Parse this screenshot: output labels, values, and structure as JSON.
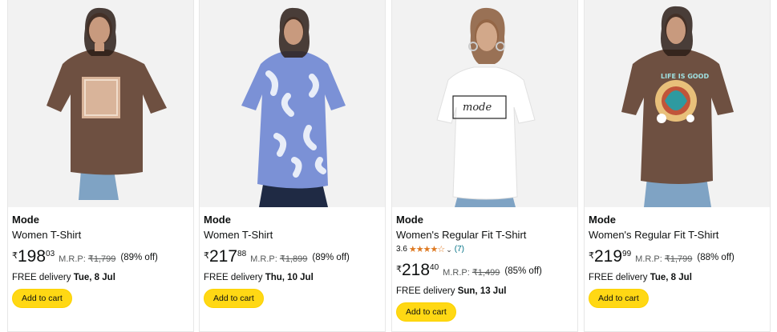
{
  "products": [
    {
      "brand": "Mode",
      "title": "Women T-Shirt",
      "currency": "₹",
      "price_whole": "198",
      "price_fraction": "03",
      "mrp_label": "M.R.P:",
      "mrp_value": "₹1,799",
      "discount": "(89% off)",
      "delivery_prefix": "FREE delivery",
      "delivery_date": "Tue, 8 Jul",
      "button_label": "Add to cart",
      "shirt_color": "#6e5041",
      "image_icon": "brown-tshirt-photo"
    },
    {
      "brand": "Mode",
      "title": "Women T-Shirt",
      "currency": "₹",
      "price_whole": "217",
      "price_fraction": "88",
      "mrp_label": "M.R.P:",
      "mrp_value": "₹1,899",
      "discount": "(89% off)",
      "delivery_prefix": "FREE delivery",
      "delivery_date": "Thu, 10 Jul",
      "button_label": "Add to cart",
      "shirt_color": "#7b91d6",
      "image_icon": "blue-floral-tshirt-photo"
    },
    {
      "brand": "Mode",
      "title": "Women's Regular Fit T-Shirt",
      "rating_value": "3.6",
      "rating_stars": "★★★★☆",
      "rating_count": "(7)",
      "currency": "₹",
      "price_whole": "218",
      "price_fraction": "40",
      "mrp_label": "M.R.P:",
      "mrp_value": "₹1,499",
      "discount": "(85% off)",
      "delivery_prefix": "FREE delivery",
      "delivery_date": "Sun, 13 Jul",
      "button_label": "Add to cart",
      "shirt_color": "#ffffff",
      "print_text": "mode",
      "image_icon": "white-mode-tshirt-photo"
    },
    {
      "brand": "Mode",
      "title": "Women's Regular Fit T-Shirt",
      "currency": "₹",
      "price_whole": "219",
      "price_fraction": "99",
      "mrp_label": "M.R.P:",
      "mrp_value": "₹1,799",
      "discount": "(88% off)",
      "delivery_prefix": "FREE delivery",
      "delivery_date": "Tue, 8 Jul",
      "button_label": "Add to cart",
      "shirt_color": "#6e5041",
      "print_text": "LIFE IS GOOD",
      "image_icon": "brown-life-is-good-tshirt-photo"
    }
  ],
  "colors": {
    "button": "#ffd814",
    "link": "#007185",
    "star": "#de7921",
    "muted": "#565959"
  }
}
